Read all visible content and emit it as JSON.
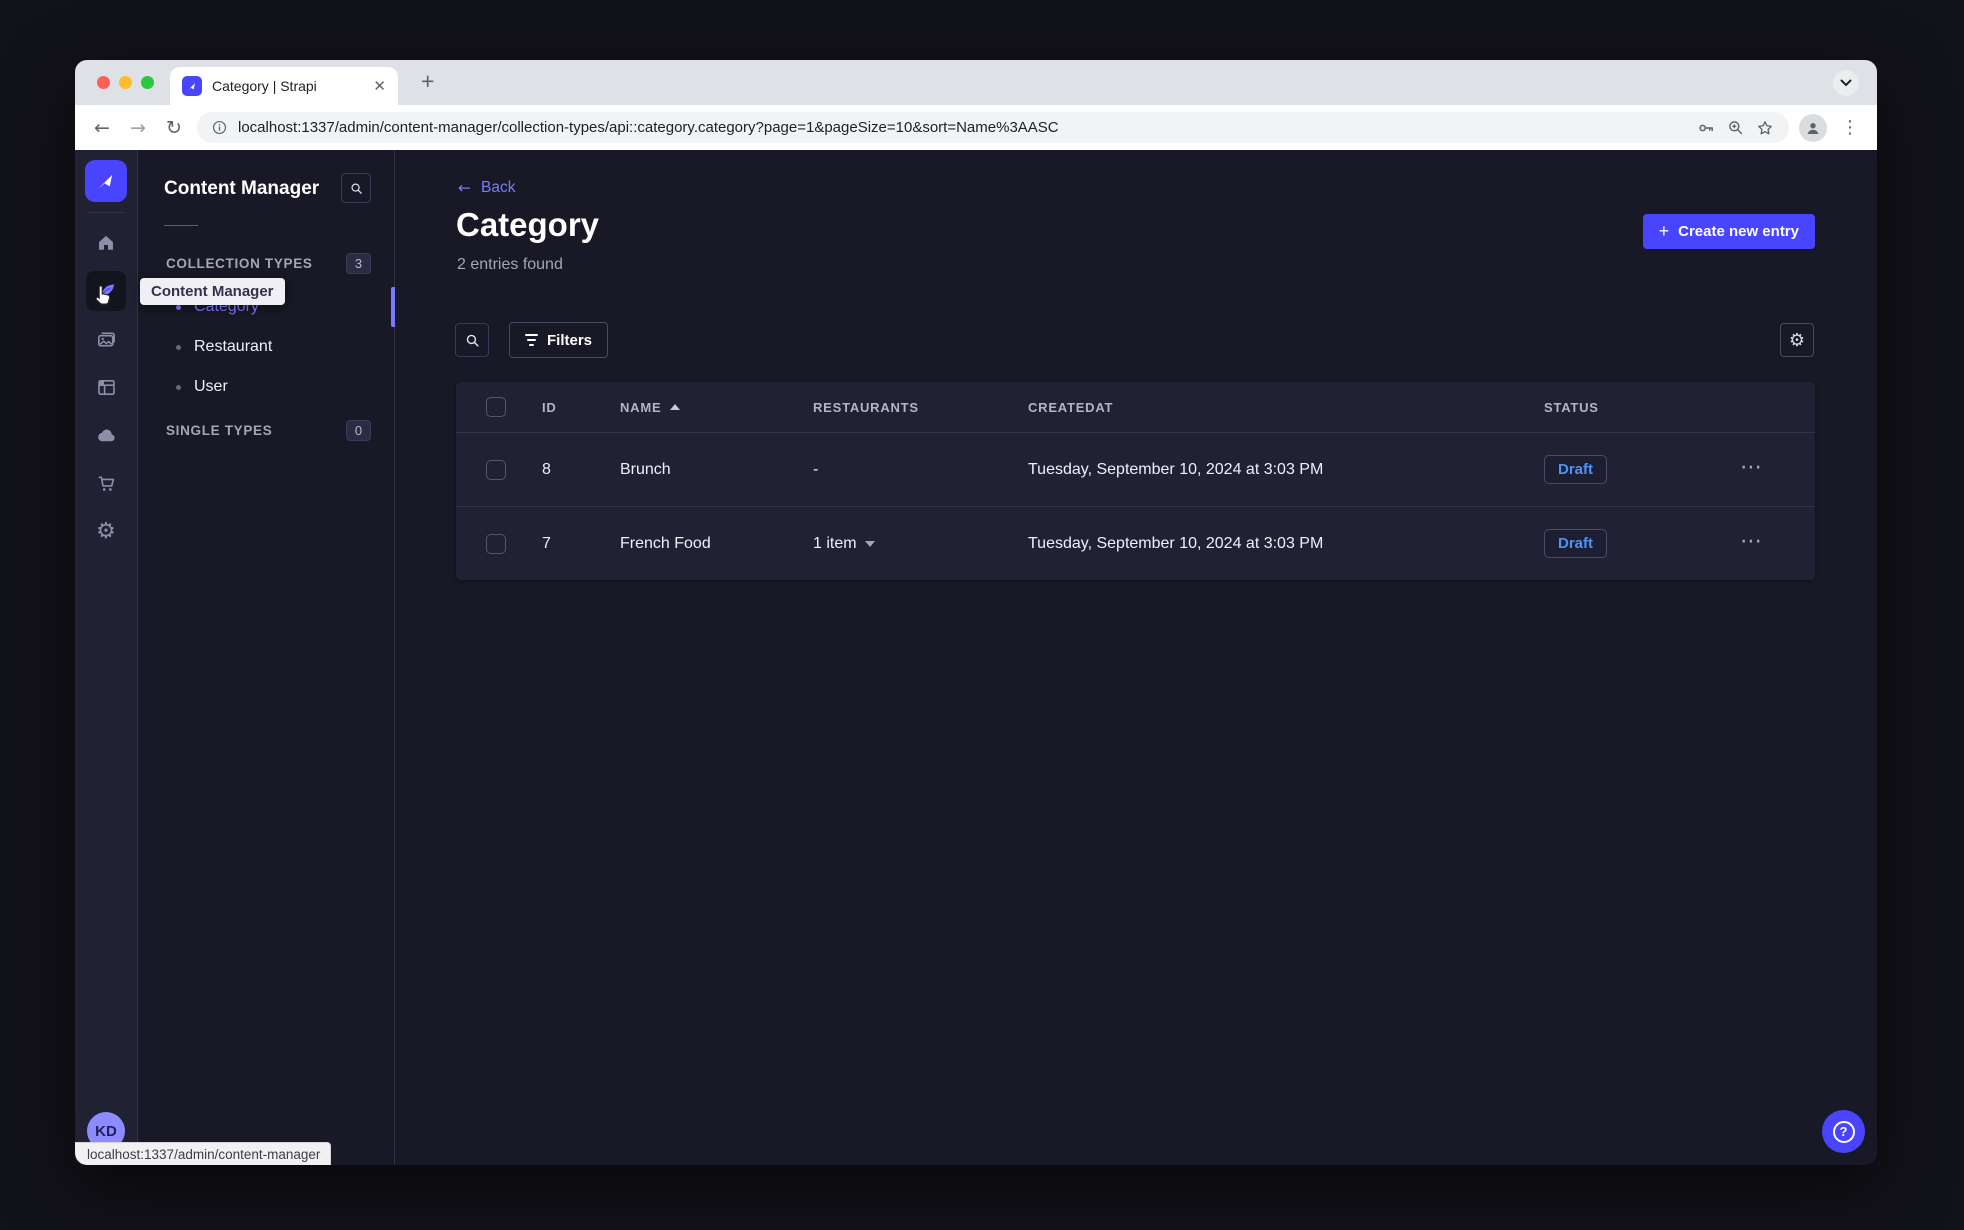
{
  "browser": {
    "tab_title": "Category | Strapi",
    "new_tab_label": "+",
    "url": "localhost:1337/admin/content-manager/collection-types/api::category.category?page=1&pageSize=10&sort=Name%3AASC",
    "status_link": "localhost:1337/admin/content-manager"
  },
  "sidebar": {
    "tooltip": "Content Manager",
    "avatar_initials": "KD",
    "rail_icons": [
      "strapi-logo",
      "home",
      "content-manager",
      "media-library",
      "content-type-builder",
      "cloud",
      "marketplace",
      "settings"
    ]
  },
  "subnav": {
    "title": "Content Manager",
    "sections": {
      "collection": {
        "label": "COLLECTION TYPES",
        "count": "3"
      },
      "single": {
        "label": "SINGLE TYPES",
        "count": "0"
      }
    },
    "items": [
      {
        "label": "Category",
        "active": true
      },
      {
        "label": "Restaurant",
        "active": false
      },
      {
        "label": "User",
        "active": false
      }
    ]
  },
  "main": {
    "back": "Back",
    "title": "Category",
    "subtitle": "2 entries found",
    "create_button": "Create new entry",
    "filters": "Filters",
    "table": {
      "headers": {
        "id": "ID",
        "name": "NAME",
        "restaurants": "RESTAURANTS",
        "createdat": "CREATEDAT",
        "status": "STATUS"
      },
      "sort": {
        "column": "NAME",
        "direction": "ascending"
      },
      "rows": [
        {
          "id": "8",
          "name": "Brunch",
          "restaurants": "-",
          "createdat": "Tuesday, September 10, 2024 at 3:03 PM",
          "status": "Draft"
        },
        {
          "id": "7",
          "name": "French Food",
          "restaurants": "1 item",
          "createdat": "Tuesday, September 10, 2024 at 3:03 PM",
          "status": "Draft"
        }
      ]
    }
  },
  "colors": {
    "primary": "#4945ff",
    "link_purple": "#7b79ff",
    "draft_text": "#4d93f7",
    "page_bg": "#181826",
    "panel_bg": "#212134"
  }
}
